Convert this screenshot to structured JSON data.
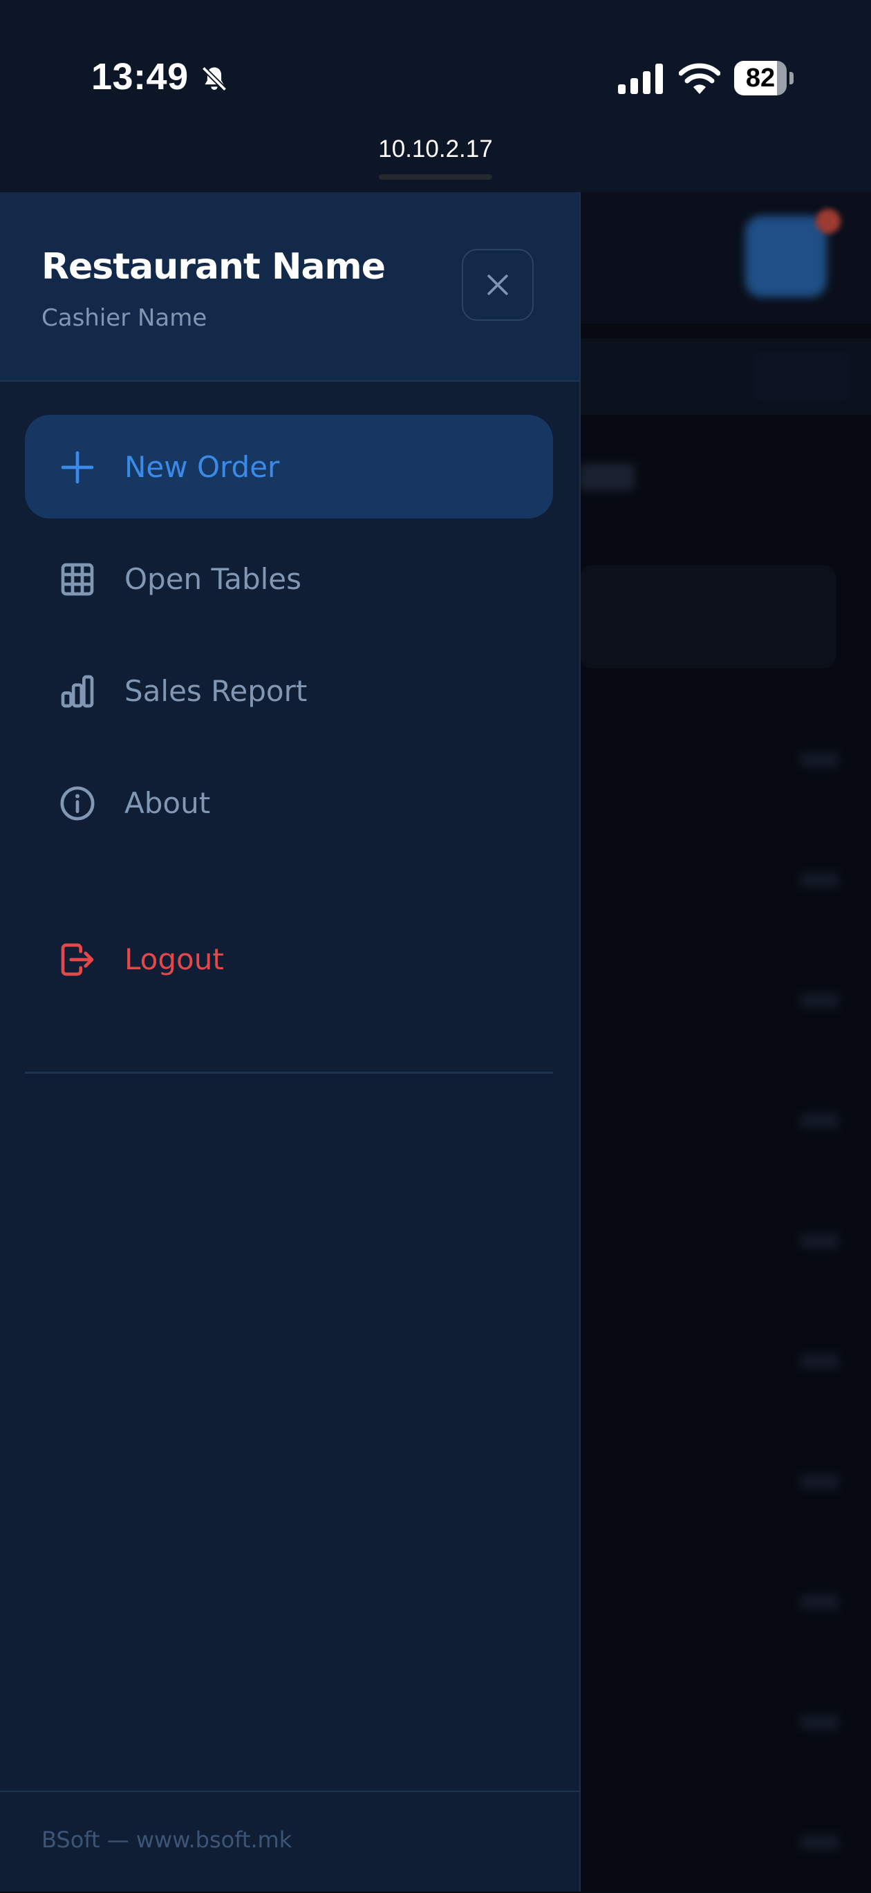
{
  "status_bar": {
    "time": "13:49",
    "battery": "82",
    "battery_level": 0.82,
    "url": "10.10.2.17",
    "icons": [
      "bell-off-icon",
      "signal-icon",
      "wifi-icon",
      "battery-icon"
    ]
  },
  "drawer": {
    "restaurant_name": "Restaurant Name",
    "cashier_name": "Cashier Name",
    "close_icon": "close-icon",
    "menu": [
      {
        "label": "New Order",
        "icon": "plus-icon",
        "active": true
      },
      {
        "label": "Open Tables",
        "icon": "table-grid-icon",
        "active": false
      },
      {
        "label": "Sales Report",
        "icon": "bar-chart-icon",
        "active": false
      },
      {
        "label": "About",
        "icon": "info-icon",
        "active": false
      }
    ],
    "logout": {
      "label": "Logout",
      "icon": "logout-icon"
    },
    "footer": "BSoft — www.bsoft.mk"
  },
  "colors": {
    "drawer_bg": "#0f1e35",
    "header_bg": "#13294a",
    "accent": "#3a8ae8",
    "active_bg": "#173763",
    "muted_text": "#8297b3",
    "danger": "#e5484b"
  }
}
